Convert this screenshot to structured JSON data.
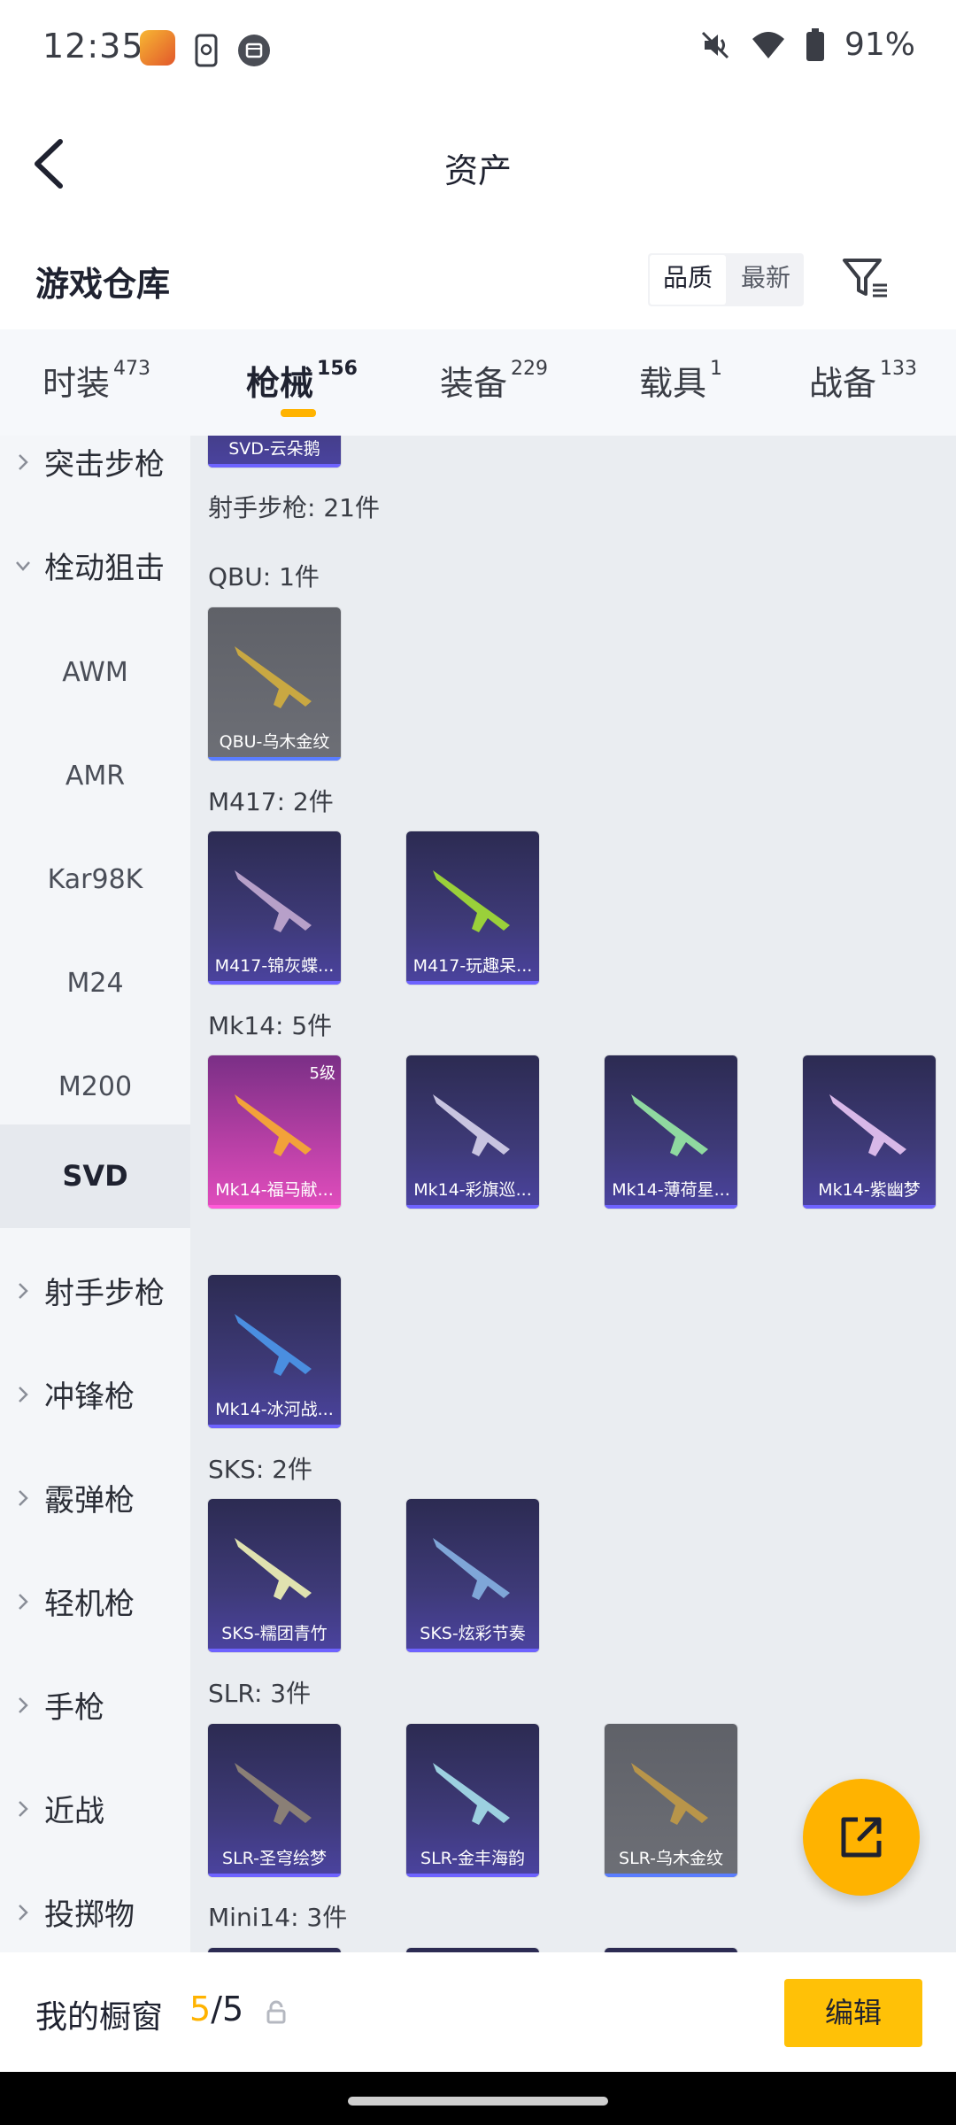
{
  "status_bar": {
    "time": "12:35",
    "battery": "91%"
  },
  "header": {
    "title": "资产"
  },
  "warehouse": {
    "title": "游戏仓库",
    "sort_options": [
      "品质",
      "最新"
    ],
    "selected_sort": "品质"
  },
  "tabs": [
    {
      "label": "时装",
      "count": "473"
    },
    {
      "label": "枪械",
      "count": "156",
      "active": true
    },
    {
      "label": "装备",
      "count": "229"
    },
    {
      "label": "载具",
      "count": "1"
    },
    {
      "label": "战备",
      "count": "133"
    }
  ],
  "sidebar": {
    "items": [
      {
        "label": "突击步枪",
        "type": "category"
      },
      {
        "label": "栓动狙击",
        "type": "category",
        "expanded": true
      },
      {
        "label": "AWM",
        "type": "sub"
      },
      {
        "label": "AMR",
        "type": "sub"
      },
      {
        "label": "Kar98K",
        "type": "sub"
      },
      {
        "label": "M24",
        "type": "sub"
      },
      {
        "label": "M200",
        "type": "sub"
      },
      {
        "label": "SVD",
        "type": "sub",
        "selected": true
      },
      {
        "label": "射手步枪",
        "type": "category"
      },
      {
        "label": "冲锋枪",
        "type": "category"
      },
      {
        "label": "霰弹枪",
        "type": "category"
      },
      {
        "label": "轻机枪",
        "type": "category"
      },
      {
        "label": "手枪",
        "type": "category"
      },
      {
        "label": "近战",
        "type": "category"
      },
      {
        "label": "投掷物",
        "type": "category"
      }
    ]
  },
  "content": {
    "partial_top_card": "SVD-云朵鹅",
    "section_header": "射手步枪: 21件",
    "groups": [
      {
        "label": "QBU: 1件",
        "items": [
          {
            "name": "QBU-乌木金纹",
            "style": "gray"
          }
        ]
      },
      {
        "label": "M417: 2件",
        "items": [
          {
            "name": "M417-锦灰蝶...",
            "style": "purple"
          },
          {
            "name": "M417-玩趣呆...",
            "style": "purple"
          }
        ]
      },
      {
        "label": "Mk14: 5件",
        "items": [
          {
            "name": "Mk14-福马献...",
            "style": "pink",
            "level": "5级"
          },
          {
            "name": "Mk14-彩旗巡...",
            "style": "purple"
          },
          {
            "name": "Mk14-薄荷星...",
            "style": "purple"
          },
          {
            "name": "Mk14-紫幽梦",
            "style": "purple"
          },
          {
            "name": "Mk14-冰河战...",
            "style": "purple"
          }
        ]
      },
      {
        "label": "SKS: 2件",
        "items": [
          {
            "name": "SKS-糯团青竹",
            "style": "purple"
          },
          {
            "name": "SKS-炫彩节奏",
            "style": "purple"
          }
        ]
      },
      {
        "label": "SLR: 3件",
        "items": [
          {
            "name": "SLR-圣穹绘梦",
            "style": "purple"
          },
          {
            "name": "SLR-金丰海韵",
            "style": "purple"
          },
          {
            "name": "SLR-乌木金纹",
            "style": "gray"
          }
        ]
      },
      {
        "label": "Mini14: 3件",
        "items": []
      }
    ]
  },
  "bottom_bar": {
    "label": "我的橱窗",
    "count_current": "5",
    "count_sep_total": "/5",
    "edit_label": "编辑"
  },
  "colors": {
    "accent": "#ffb300",
    "edit_button": "#ffc107",
    "content_bg": "#eaedf1"
  }
}
